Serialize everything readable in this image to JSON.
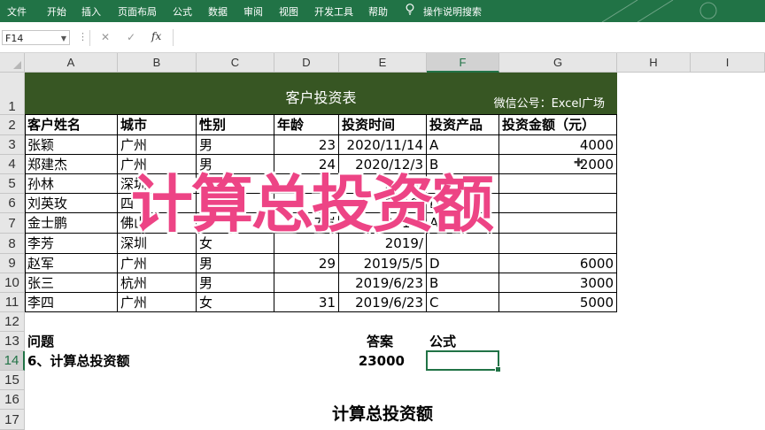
{
  "ribbon": {
    "tabs": [
      "文件",
      "开始",
      "插入",
      "页面布局",
      "公式",
      "数据",
      "审阅",
      "视图",
      "开发工具",
      "帮助"
    ],
    "tell_me": "操作说明搜索"
  },
  "formula_bar": {
    "name_box": "F14",
    "fx": "fx",
    "value": ""
  },
  "columns": [
    "A",
    "B",
    "C",
    "D",
    "E",
    "F",
    "G",
    "H",
    "I"
  ],
  "rows": [
    "1",
    "2",
    "3",
    "4",
    "5",
    "6",
    "7",
    "8",
    "9",
    "10",
    "11",
    "12",
    "13",
    "14",
    "15",
    "16",
    "17"
  ],
  "selected": {
    "column": "F",
    "row": "14"
  },
  "table": {
    "title": "客户投资表",
    "watermark": "微信公号：Excel广场",
    "headers": [
      "客户姓名",
      "城市",
      "性别",
      "年龄",
      "投资时间",
      "投资产品",
      "投资金额（元）"
    ],
    "rows": [
      [
        "张颖",
        "广州",
        "男",
        "23",
        "2020/11/14",
        "A",
        "4000"
      ],
      [
        "郑建杰",
        "广州",
        "男",
        "24",
        "2020/12/3",
        "B",
        "2000"
      ],
      [
        "孙林",
        "深圳",
        "女",
        "",
        "2019/",
        "",
        ""
      ],
      [
        "刘英玫",
        "四",
        "",
        "",
        "2019/",
        "D",
        ""
      ],
      [
        "金士鹏",
        "佛山",
        "",
        "7岁",
        "2019/",
        "A",
        ""
      ],
      [
        "李芳",
        "深圳",
        "女",
        "",
        "2019/",
        "",
        ""
      ],
      [
        "赵军",
        "广州",
        "男",
        "29",
        "2019/5/5",
        "D",
        "6000"
      ],
      [
        "张三",
        "杭州",
        "男",
        "",
        "2019/6/23",
        "B",
        "3000"
      ],
      [
        "李四",
        "广州",
        "女",
        "31",
        "2019/6/23",
        "C",
        "5000"
      ]
    ]
  },
  "questions": {
    "q_label": "问题",
    "answer_label": "答案",
    "formula_label": "公式",
    "q_text": "6、计算总投资额",
    "answer": "23000"
  },
  "overlay_text": "计算总投资额",
  "caption": "计算总投资额",
  "colors": {
    "ribbon": "#217346",
    "title_band": "#375623",
    "overlay": "#ed4485"
  }
}
